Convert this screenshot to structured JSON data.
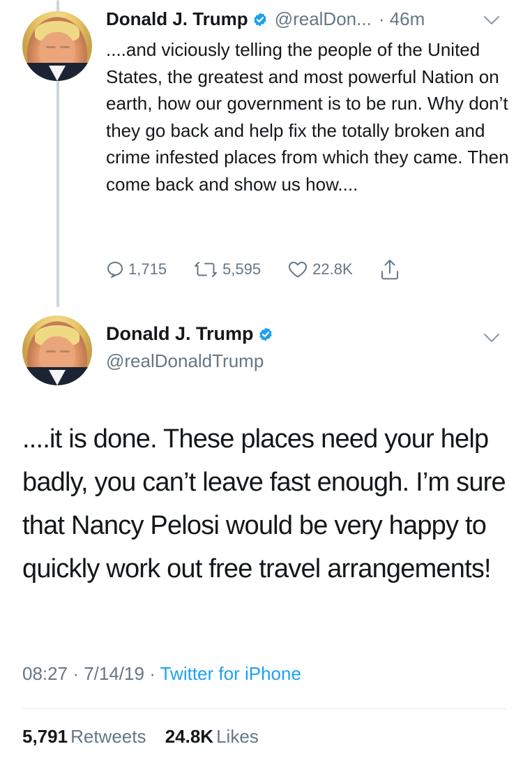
{
  "tweet1": {
    "name": "Donald J. Trump",
    "handle": "@realDon...",
    "time": "46m",
    "text": "....and viciously telling the people of the United States, the greatest and most powerful Nation on earth, how our government is to be run. Why don’t they go back and help fix the totally broken and crime infested places from which they came. Then come back and show us how....",
    "replies": "1,715",
    "retweets": "5,595",
    "likes": "22.8K"
  },
  "tweet2": {
    "name": "Donald J. Trump",
    "handle": "@realDonaldTrump",
    "text": "....it is done. These places need your help badly, you can’t leave fast enough. I’m sure that Nancy Pelosi would be very happy to quickly work out free travel arrangements!",
    "time": "08:27",
    "date": "7/14/19",
    "source": "Twitter for iPhone",
    "retweets_count": "5,791",
    "retweets_label": "Retweets",
    "likes_count": "24.8K",
    "likes_label": "Likes"
  },
  "colors": {
    "accent": "#1da1f2",
    "secondary_text": "#657786",
    "thread_line": "#ccd6dd"
  },
  "icons": [
    "verified-badge-icon",
    "chevron-down-icon",
    "reply-icon",
    "retweet-icon",
    "like-icon",
    "share-icon"
  ]
}
